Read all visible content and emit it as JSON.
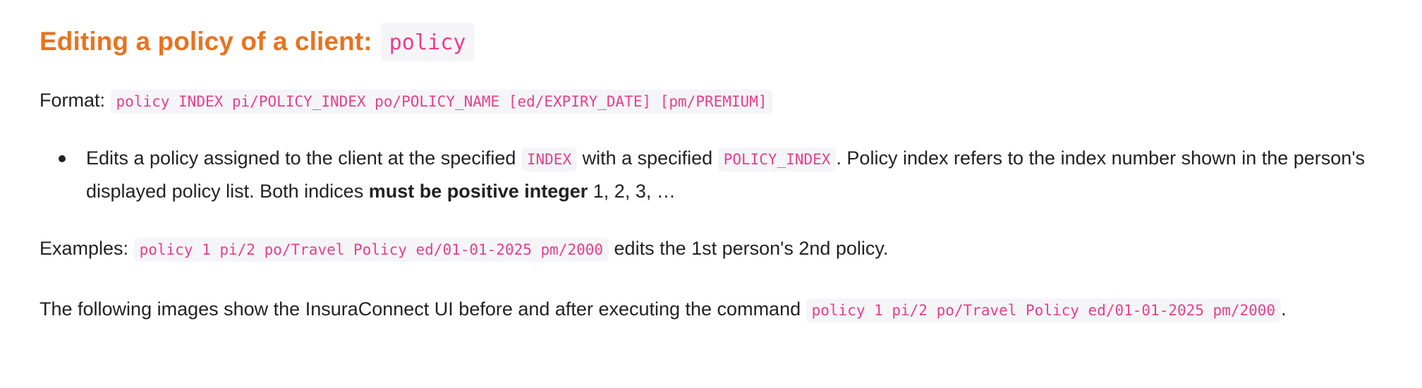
{
  "section": {
    "title": "Editing a policy of a client:",
    "command_word": "policy"
  },
  "format": {
    "label": "Format:",
    "syntax": "policy INDEX pi/POLICY_INDEX po/POLICY_NAME [ed/EXPIRY_DATE] [pm/PREMIUM]"
  },
  "bullet": {
    "text_1": "Edits a policy assigned to the client at the specified ",
    "code_index": "INDEX",
    "text_2": " with a specified ",
    "code_policy_index": "POLICY_INDEX",
    "text_3": ". Policy index refers to the index number shown in the person's displayed policy list. Both indices ",
    "bold_text": "must be positive integer",
    "text_4": " 1, 2, 3, …"
  },
  "examples": {
    "label": "Examples:",
    "command": "policy 1 pi/2 po/Travel Policy ed/01-01-2025 pm/2000",
    "description": " edits the 1st person's 2nd policy."
  },
  "images_note": {
    "text": "The following images show the InsuraConnect UI before and after executing the command ",
    "command": "policy 1 pi/2 po/Travel Policy ed/01-01-2025 pm/2000",
    "end": "."
  }
}
